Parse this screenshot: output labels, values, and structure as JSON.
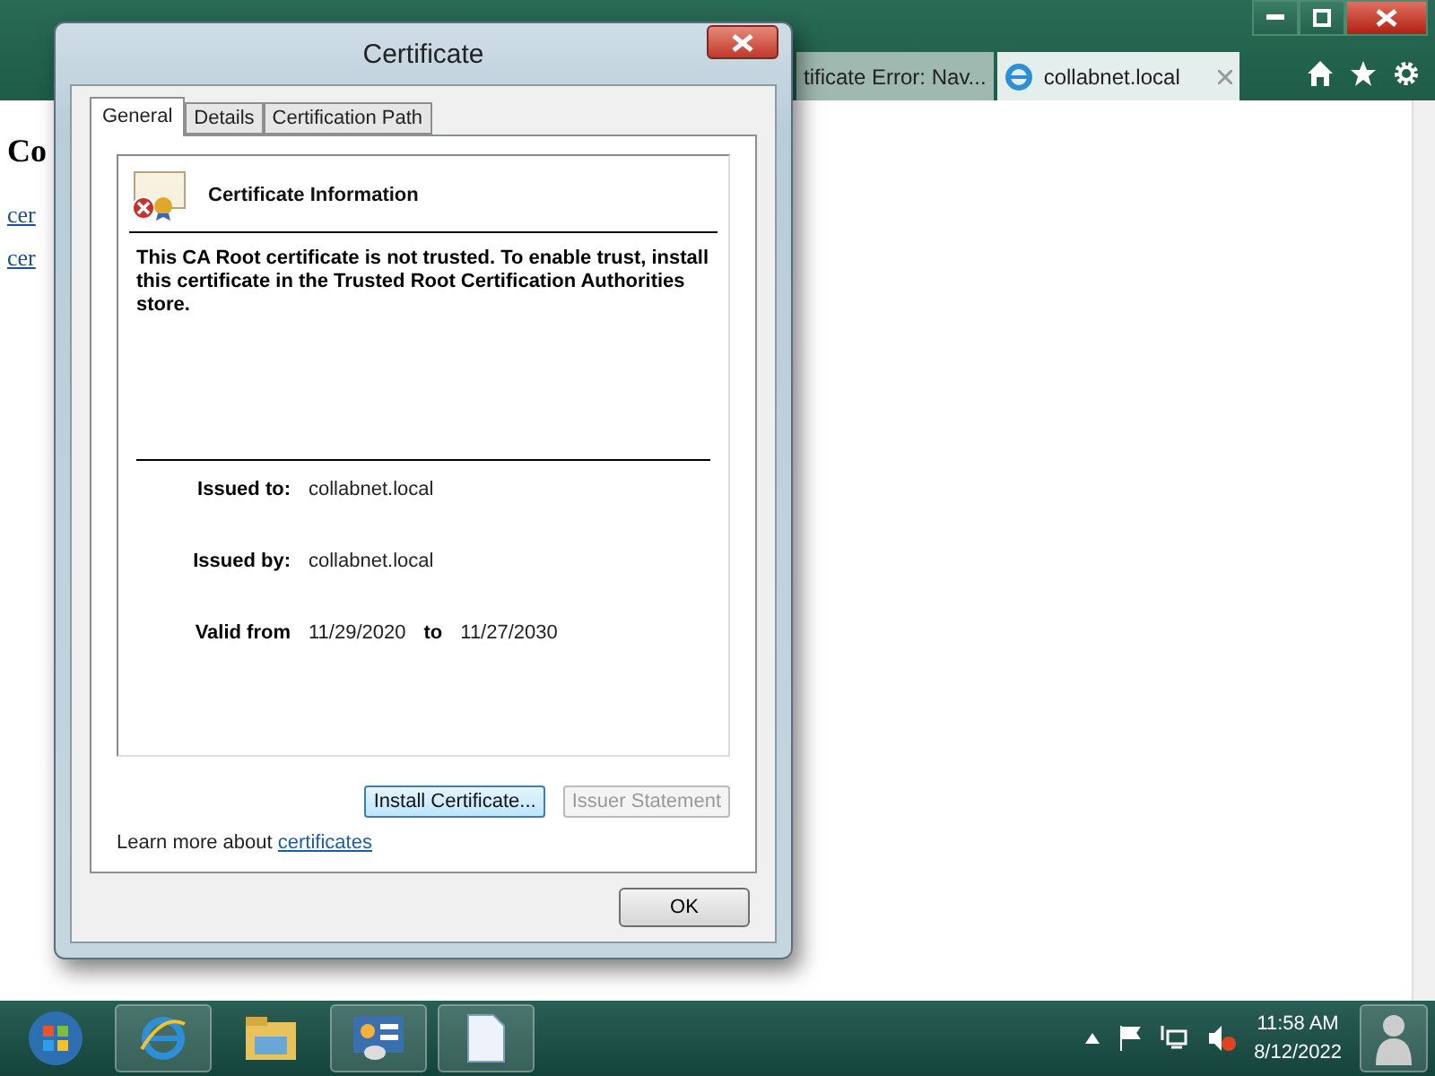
{
  "browser": {
    "tabs": [
      {
        "label": "tificate Error: Nav...",
        "selected": false
      },
      {
        "label": "collabnet.local",
        "selected": true
      }
    ],
    "page": {
      "heading": "Co",
      "links": [
        "cer",
        "cer"
      ]
    }
  },
  "dialog": {
    "title": "Certificate",
    "tabs": [
      {
        "label": "General",
        "selected": true
      },
      {
        "label": "Details",
        "selected": false
      },
      {
        "label": "Certification Path",
        "selected": false
      }
    ],
    "info_title": "Certificate Information",
    "message": "This CA Root certificate is not trusted. To enable trust, install this certificate in the Trusted Root Certification Authorities store.",
    "issued_to": {
      "label": "Issued to:",
      "value": "collabnet.local"
    },
    "issued_by": {
      "label": "Issued by:",
      "value": "collabnet.local"
    },
    "valid": {
      "label": "Valid from",
      "from": "11/29/2020",
      "to_label": "to",
      "to": "11/27/2030"
    },
    "buttons": [
      {
        "label": "Install Certificate...",
        "disabled": false
      },
      {
        "label": "Issuer Statement",
        "disabled": true
      }
    ],
    "learn_more": {
      "text": "Learn more about",
      "link": "certificates"
    },
    "ok": "OK"
  },
  "taskbar": {
    "time": "11:58 AM",
    "date": "8/12/2022"
  }
}
